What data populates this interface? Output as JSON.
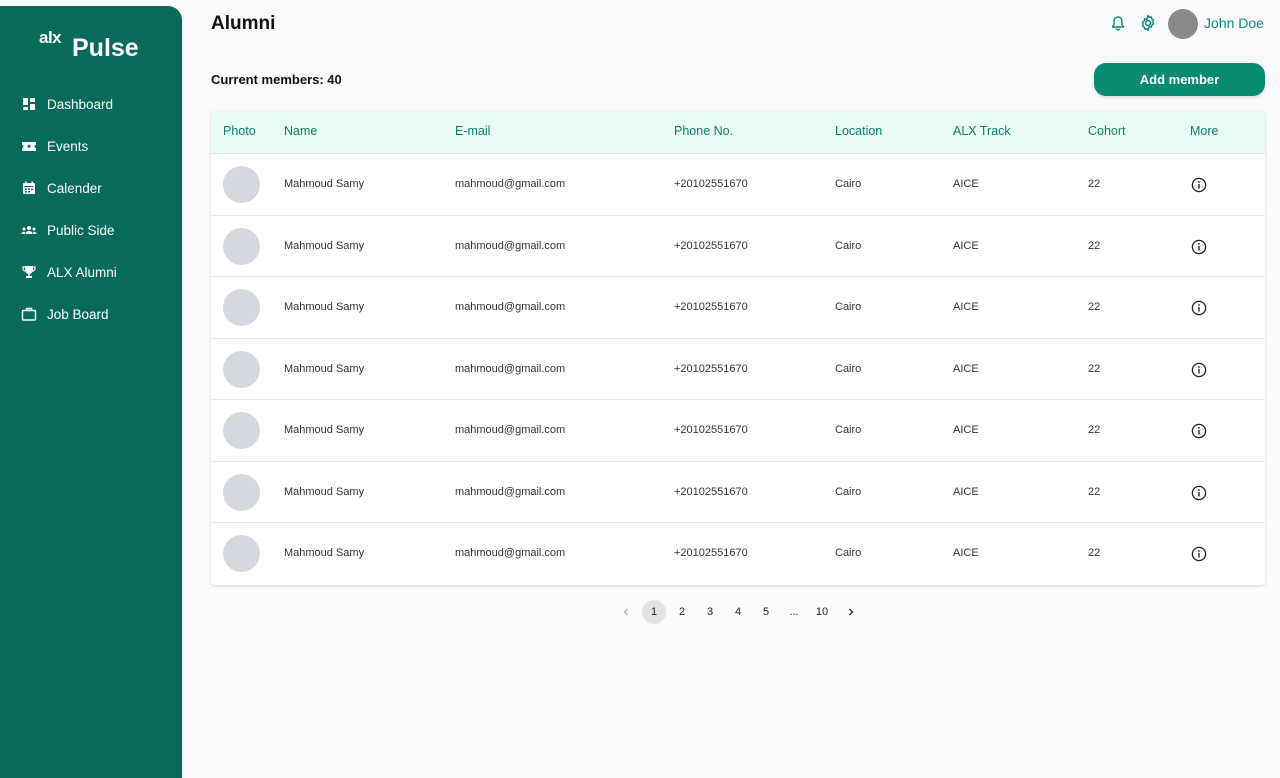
{
  "brand": {
    "prefix": "alx",
    "name": "Pulse"
  },
  "sidebar": {
    "items": [
      {
        "label": "Dashboard",
        "icon": "dashboard-icon"
      },
      {
        "label": "Events",
        "icon": "ticket-icon"
      },
      {
        "label": "Calender",
        "icon": "calendar-icon"
      },
      {
        "label": "Public Side",
        "icon": "people-icon"
      },
      {
        "label": "ALX Alumni",
        "icon": "trophy-icon"
      },
      {
        "label": "Job Board",
        "icon": "briefcase-icon"
      }
    ]
  },
  "header": {
    "title": "Alumni",
    "user_name": "John Doe"
  },
  "members": {
    "count_label": "Current members: 40",
    "add_button_label": "Add member"
  },
  "table": {
    "columns": [
      "Photo",
      "Name",
      "E-mail",
      "Phone No.",
      "Location",
      "ALX Track",
      "Cohort",
      "More"
    ],
    "rows": [
      {
        "name": "Mahmoud Samy",
        "email": "mahmoud@gmail.com",
        "phone": "+20102551670",
        "location": "Cairo",
        "track": "AICE",
        "cohort": "22"
      },
      {
        "name": "Mahmoud Samy",
        "email": "mahmoud@gmail.com",
        "phone": "+20102551670",
        "location": "Cairo",
        "track": "AICE",
        "cohort": "22"
      },
      {
        "name": "Mahmoud Samy",
        "email": "mahmoud@gmail.com",
        "phone": "+20102551670",
        "location": "Cairo",
        "track": "AICE",
        "cohort": "22"
      },
      {
        "name": "Mahmoud Samy",
        "email": "mahmoud@gmail.com",
        "phone": "+20102551670",
        "location": "Cairo",
        "track": "AICE",
        "cohort": "22"
      },
      {
        "name": "Mahmoud Samy",
        "email": "mahmoud@gmail.com",
        "phone": "+20102551670",
        "location": "Cairo",
        "track": "AICE",
        "cohort": "22"
      },
      {
        "name": "Mahmoud Samy",
        "email": "mahmoud@gmail.com",
        "phone": "+20102551670",
        "location": "Cairo",
        "track": "AICE",
        "cohort": "22"
      },
      {
        "name": "Mahmoud Samy",
        "email": "mahmoud@gmail.com",
        "phone": "+20102551670",
        "location": "Cairo",
        "track": "AICE",
        "cohort": "22"
      }
    ]
  },
  "pagination": {
    "pages": [
      "1",
      "2",
      "3",
      "4",
      "5",
      "...",
      "10"
    ],
    "current": "1"
  },
  "colors": {
    "sidebar": "#076a5b",
    "accent": "#0a8a73",
    "table_header": "#e8fbf6"
  }
}
